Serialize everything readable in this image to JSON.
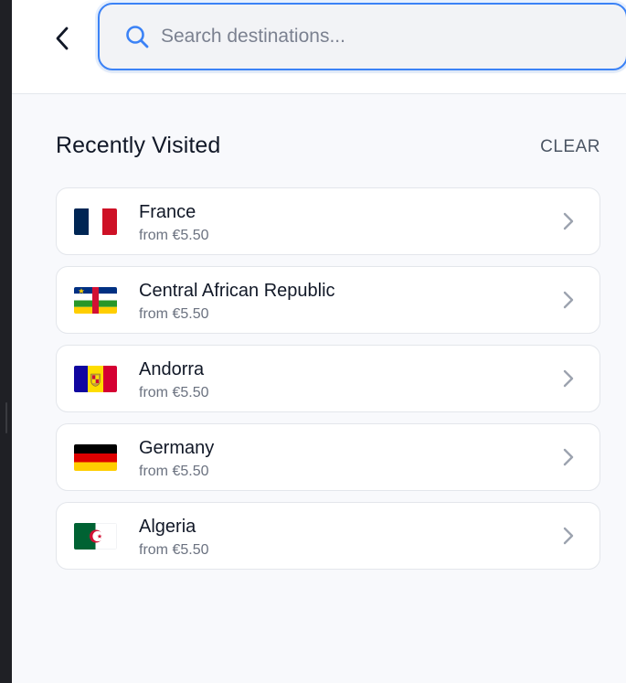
{
  "search": {
    "placeholder": "Search destinations...",
    "value": ""
  },
  "recent": {
    "title": "Recently Visited",
    "clear_label": "CLEAR",
    "items": [
      {
        "name": "France",
        "price": "from €5.50",
        "flag": "france-flag-icon"
      },
      {
        "name": "Central African Republic",
        "price": "from €5.50",
        "flag": "central-african-republic-flag-icon"
      },
      {
        "name": "Andorra",
        "price": "from €5.50",
        "flag": "andorra-flag-icon"
      },
      {
        "name": "Germany",
        "price": "from €5.50",
        "flag": "germany-flag-icon"
      },
      {
        "name": "Algeria",
        "price": "from €5.50",
        "flag": "algeria-flag-icon"
      }
    ]
  },
  "icons": {
    "back": "chevron-left-icon",
    "search": "search-icon",
    "row_arrow": "chevron-right-icon"
  },
  "colors": {
    "accent": "#3b82f6",
    "background": "#f8f9fc",
    "card": "#ffffff",
    "text_primary": "#111827",
    "text_secondary": "#6b7280"
  }
}
